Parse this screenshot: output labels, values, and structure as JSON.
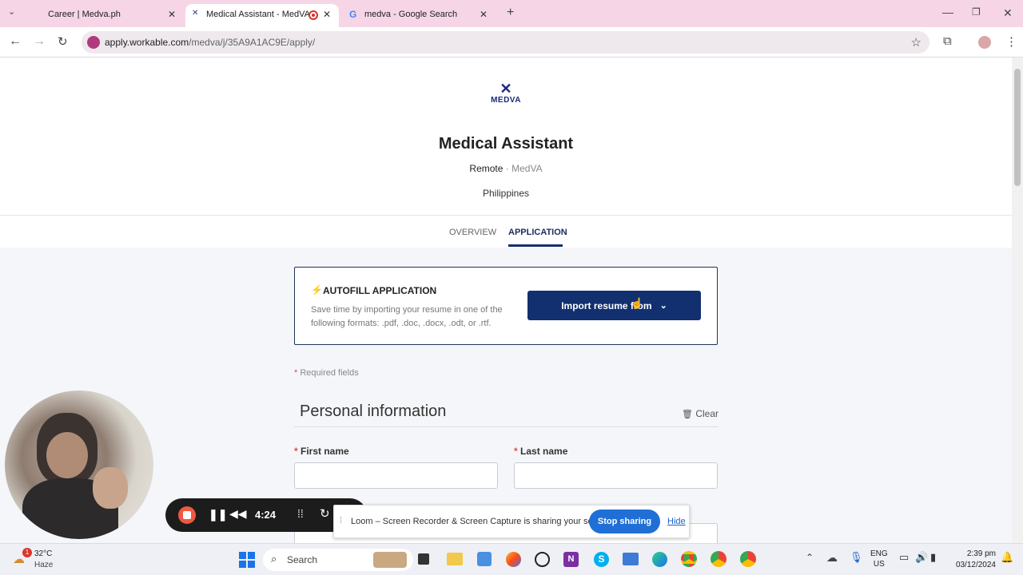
{
  "browser": {
    "tabs": [
      {
        "label": "Career | Medva.ph"
      },
      {
        "label": "Medical Assistant - MedVA"
      },
      {
        "label": "medva - Google Search"
      }
    ],
    "url_host": "apply.workable.com",
    "url_path": "/medva/j/35A9A1AC9E/apply/"
  },
  "header": {
    "logo_text": "MEDVA",
    "job_title": "Medical Assistant",
    "workplace": "Remote",
    "separator": " · MedVA",
    "location": "Philippines"
  },
  "tabs": {
    "overview": "OVERVIEW",
    "application": "APPLICATION"
  },
  "autofill": {
    "title": "AUTOFILL APPLICATION",
    "description": "Save time by importing your resume in one of the following formats: .pdf, .doc, .docx, .odt, or .rtf.",
    "button": "Import resume from"
  },
  "form": {
    "required_note": "Required fields",
    "section_title": "Personal information",
    "clear": "Clear",
    "first_name_label": "First name",
    "last_name_label": "Last name",
    "required_mark": "*"
  },
  "loom": {
    "timer": "4:24",
    "share_text": "Loom – Screen Recorder & Screen Capture is sharing your screen.",
    "stop": "Stop sharing",
    "hide": "Hide"
  },
  "taskbar": {
    "weather_temp": "32°C",
    "weather_desc": "Haze",
    "weather_badge": "1",
    "search": "Search",
    "lang1": "ENG",
    "lang2": "US",
    "time": "2:39 pm",
    "date": "03/12/2024"
  },
  "colors": {
    "accent": "#12306f",
    "required": "#e5484d",
    "loom_blue": "#1f6fd6",
    "tabbar": "#f6d6e6"
  }
}
